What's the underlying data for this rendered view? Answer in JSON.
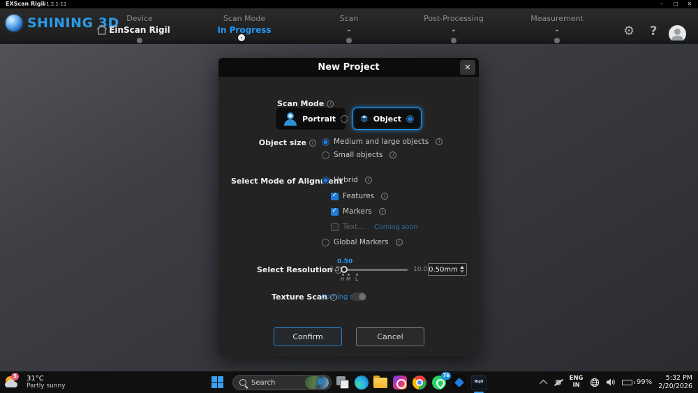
{
  "title_bar": {
    "app": "EXScan Rigil",
    "version": "v1.2.1-11",
    "minimize": "–",
    "maximize": "▢",
    "close": "✕"
  },
  "header": {
    "brand": "SHINING 3D",
    "steps": [
      {
        "label": "Device",
        "value": "EinScan Rigil"
      },
      {
        "label": "Scan Mode",
        "value": "In Progress"
      },
      {
        "label": "Scan",
        "value": "-"
      },
      {
        "label": "Post-Processing",
        "value": "-"
      },
      {
        "label": "Measurement",
        "value": "-"
      }
    ]
  },
  "modal": {
    "title": "New Project",
    "close": "✕",
    "scan_mode": {
      "label": "Scan Mode",
      "portrait": "Portrait",
      "object": "Object"
    },
    "object_size": {
      "label": "Object size",
      "option1": "Medium and large objects",
      "option2": "Small objects"
    },
    "alignment": {
      "label": "Select Mode of Alignment",
      "hybrid": "Hybrid",
      "features": "Features",
      "markers": "Markers",
      "text": "Text...",
      "text_badge": "Coming soon",
      "global_markers": "Global Markers"
    },
    "resolution": {
      "label": "Select Resolution",
      "min": "0.5",
      "max": "10.0",
      "value": "0.50",
      "input_value": "0.50mm",
      "tick_h": "H",
      "tick_m": "M",
      "tick_l": "L"
    },
    "texture": {
      "label": "Texture Scan",
      "badge": "Coming soon"
    },
    "confirm": "Confirm",
    "cancel": "Cancel"
  },
  "taskbar": {
    "weather": {
      "temp": "31°C",
      "desc": "Partly sunny",
      "badge": "5"
    },
    "search": {
      "placeholder": "Search"
    },
    "whatsapp_badge": "76",
    "rigil_label": "Rigil",
    "tray": {
      "lang_line1": "ENG",
      "lang_line2": "IN",
      "battery": "99%",
      "time": "5:32 PM",
      "date": "2/20/2026"
    }
  },
  "colors": {
    "accent": "#2196f3",
    "header_blue": "#2b9ae8",
    "check_blue": "#1f7bd9"
  }
}
